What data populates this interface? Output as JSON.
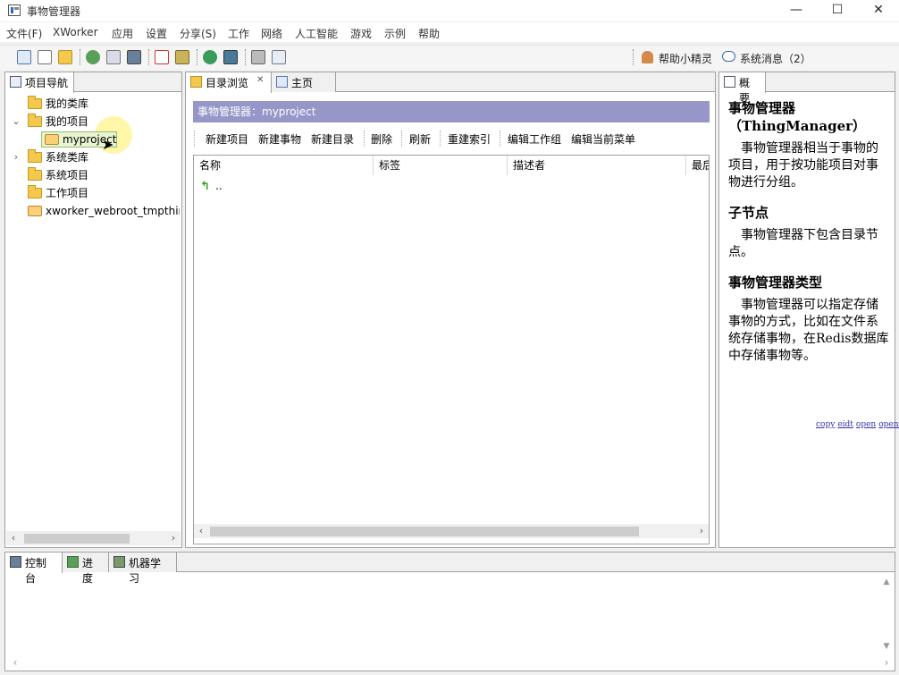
{
  "window": {
    "title": "事物管理器",
    "minimize": "—",
    "maximize": "☐",
    "close": "✕"
  },
  "menu": [
    "文件(F)",
    "XWorker",
    "应用",
    "设置",
    "分享(S)",
    "工作",
    "网络",
    "人工智能",
    "游戏",
    "示例",
    "帮助"
  ],
  "toolbar": {
    "icons": [
      "window-icon",
      "new-file-icon",
      "open-folder-icon",
      "refresh-icon",
      "image-icon",
      "monitor-icon",
      "pdf-icon",
      "tools-icon",
      "globe-icon",
      "computer-icon",
      "printer-icon",
      "document-icon"
    ],
    "helper": "帮助小精灵",
    "messages": "系统消息（2）"
  },
  "nav": {
    "tab": "项目导航",
    "items": [
      {
        "label": "我的类库",
        "type": "folder",
        "expander": ""
      },
      {
        "label": "我的项目",
        "type": "folder",
        "expander": "⌄"
      },
      {
        "label": "myproject",
        "type": "project",
        "expander": ""
      },
      {
        "label": "系统类库",
        "type": "folder",
        "expander": "›"
      },
      {
        "label": "系统项目",
        "type": "folder",
        "expander": ""
      },
      {
        "label": "工作项目",
        "type": "folder",
        "expander": ""
      },
      {
        "label": "xworker_webroot_tmpthin",
        "type": "project",
        "expander": ""
      }
    ]
  },
  "center": {
    "tabs": [
      {
        "label": "目录浏览",
        "close": "✕"
      },
      {
        "label": "主页"
      }
    ],
    "banner": "事物管理器：myproject",
    "actions": [
      "新建项目",
      "新建事物",
      "新建目录",
      "删除",
      "刷新",
      "重建索引",
      "编辑工作组",
      "编辑当前菜单"
    ],
    "columns": [
      "名称",
      "标签",
      "描述者",
      "最后"
    ],
    "rows": [
      {
        "name": ".."
      }
    ]
  },
  "overview": {
    "tab": "概要",
    "title": "事物管理器",
    "subtitle": "（ThingManager）",
    "para1": "事物管理器相当于事物的项目，用于按功能项目对事物进行分组。",
    "h2": "子节点",
    "para2": "事物管理器下包含目录节点。",
    "h3": "事物管理器类型",
    "para3": "事物管理器可以指定存储事物的方式，比如在文件系统存储事物，在Redis数据库中存储事物等。",
    "links": [
      "copy",
      "eidt",
      "open",
      "openr"
    ]
  },
  "bottom": {
    "tabs": [
      "控制台",
      "进度",
      "机器学习"
    ]
  },
  "colors": {
    "banner": "#9696c8",
    "selection": "#fff8b0",
    "folder": "#f2c94c"
  }
}
